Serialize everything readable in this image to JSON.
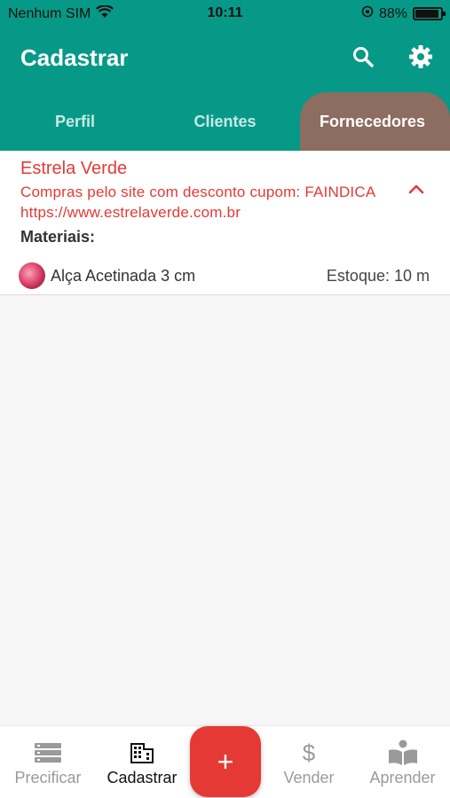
{
  "status_bar": {
    "carrier": "Nenhum SIM",
    "time": "10:11",
    "battery": "88%"
  },
  "app_bar": {
    "title": "Cadastrar",
    "actions": [
      "search-icon",
      "gear-icon"
    ]
  },
  "tabs": [
    {
      "label": "Perfil",
      "selected": false
    },
    {
      "label": "Clientes",
      "selected": false
    },
    {
      "label": "Fornecedores",
      "selected": true
    }
  ],
  "supplier": {
    "name": "Estrela Verde",
    "description": "Compras pelo site com desconto cupom: FAINDICA https://www.estrelaverde.com.br",
    "materials_label": "Materiais:",
    "materials": [
      {
        "name": "Alça Acetinada 3 cm",
        "stock": "Estoque: 10 m"
      }
    ]
  },
  "bottom_nav": {
    "items": [
      {
        "label": "Precificar",
        "icon": "list-icon"
      },
      {
        "label": "Cadastrar",
        "icon": "building-icon",
        "active": true
      },
      {
        "label": "Vender",
        "icon": "dollar-icon"
      },
      {
        "label": "Aprender",
        "icon": "book-icon"
      }
    ],
    "fab_label": "+"
  },
  "colors": {
    "primary": "#079987",
    "accent": "#e53935",
    "selected_tab": "#8c6d60"
  }
}
